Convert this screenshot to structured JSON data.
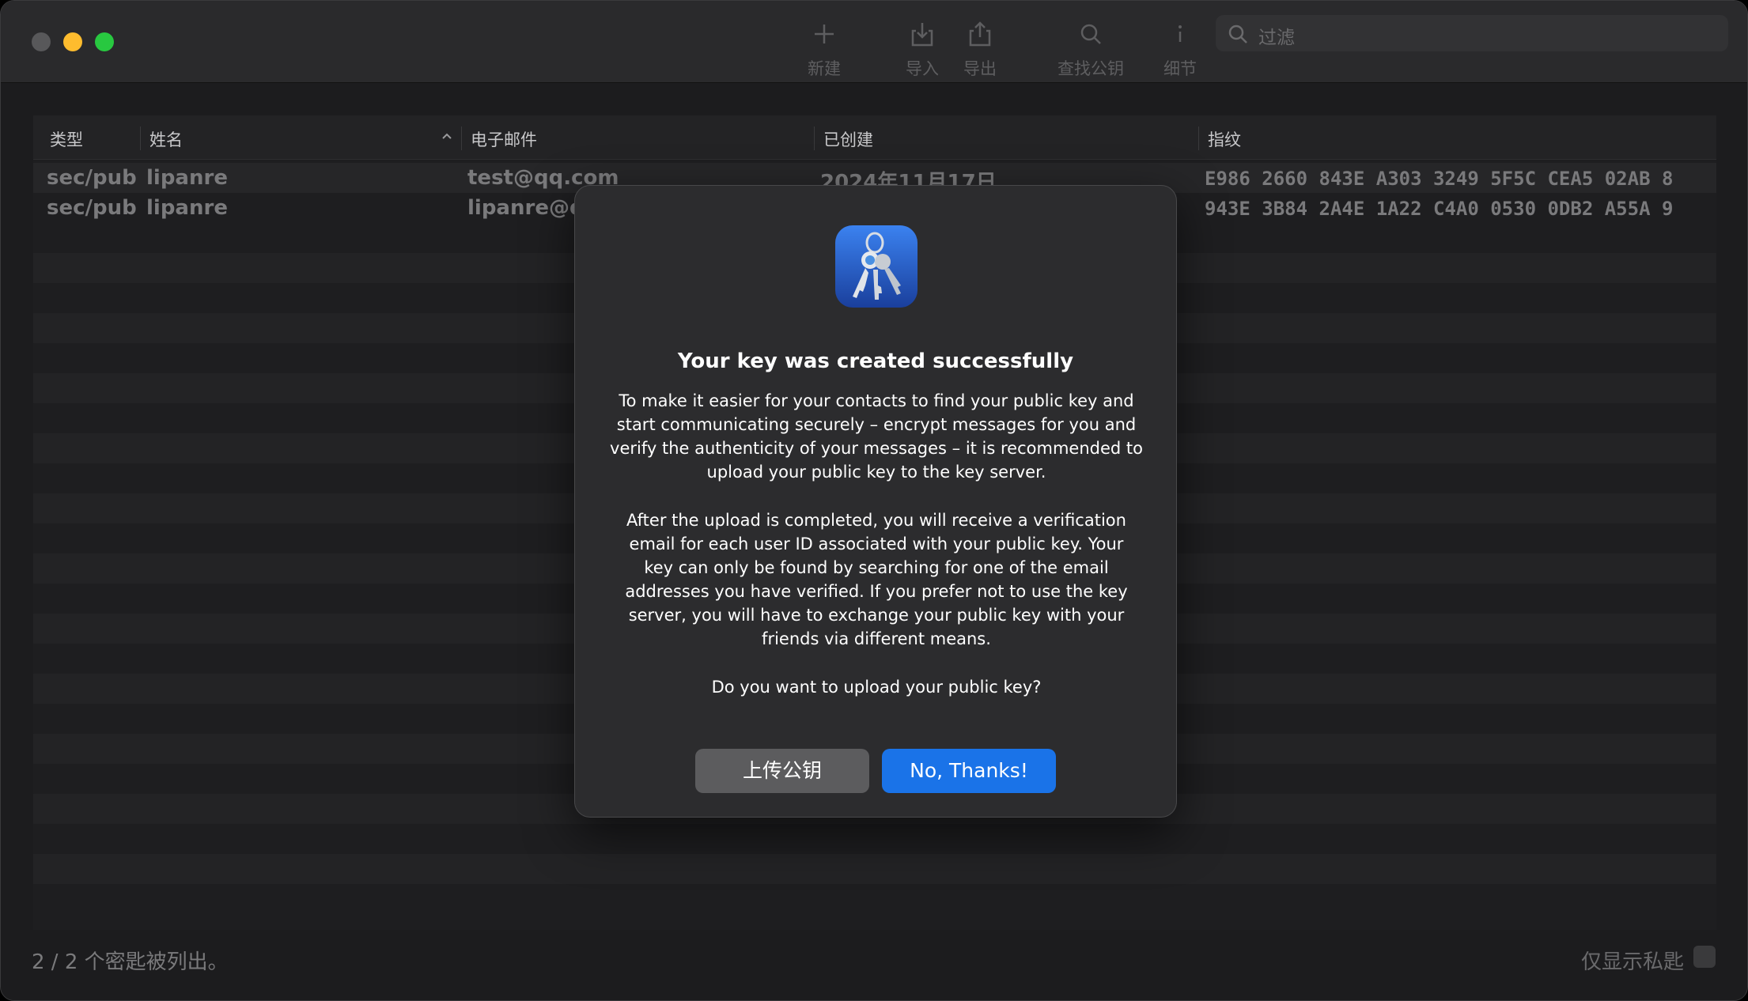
{
  "toolbar": {
    "new_label": "新建",
    "import_label": "导入",
    "export_label": "导出",
    "lookup_label": "查找公钥",
    "details_label": "细节"
  },
  "search": {
    "placeholder": "过滤"
  },
  "table": {
    "headers": [
      "类型",
      "姓名",
      "电子邮件",
      "已创建",
      "指纹"
    ],
    "rows": [
      {
        "type": "sec/pub",
        "name": "lipanre",
        "email": "test@qq.com",
        "created": "2024年11月17日",
        "fingerprint": "E986 2660 843E A303 3249  5F5C CEA5 02AB 8"
      },
      {
        "type": "sec/pub",
        "name": "lipanre",
        "email": "lipanre@qq",
        "created": "",
        "fingerprint": "943E 3B84 2A4E 1A22 C4A0  0530 0DB2 A55A 9"
      }
    ]
  },
  "footer": {
    "count_text": "2 / 2 个密匙被列出。",
    "private_only_label": "仅显示私匙"
  },
  "dialog": {
    "title": "Your key was created successfully",
    "paragraph1_lines": [
      "To make it easier for your contacts to find your public key and",
      "start communicating securely – encrypt messages for you and",
      "verify the authenticity of your messages – it is recommended to",
      "upload your public key to the key server."
    ],
    "paragraph2_lines": [
      "After the upload is completed, you will receive a verification",
      "email for each user ID associated with your public key. Your",
      "key can only be found by searching for one of the email",
      "addresses you have verified. If you prefer not to use the key",
      "server, you will have to exchange your public key with your",
      "friends via different means."
    ],
    "question": "Do you want to upload your public key?",
    "upload_button": "上传公钥",
    "no_thanks_button": "No, Thanks!"
  },
  "colors": {
    "accent": "#1a73e8",
    "secondary_button": "#5c5c5e",
    "traffic_minimize": "#febc2e",
    "traffic_maximize": "#28c840"
  }
}
